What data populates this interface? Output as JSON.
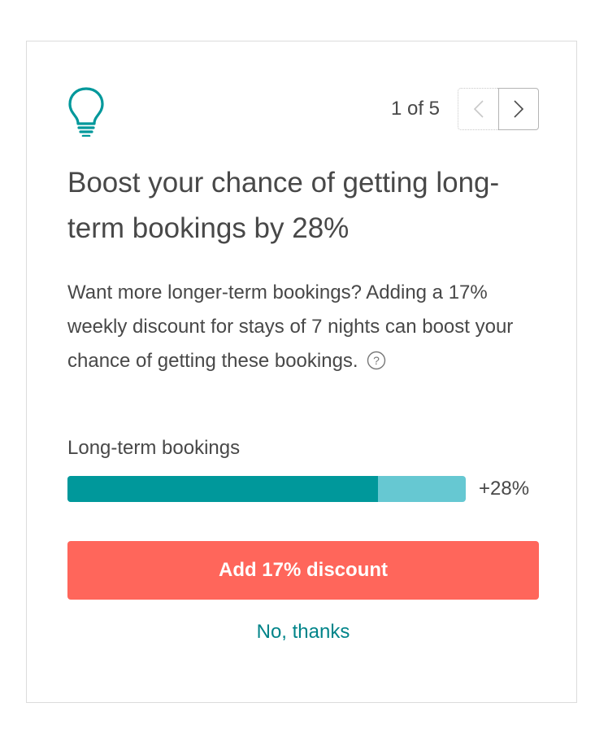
{
  "colors": {
    "accent": "#008489",
    "bar_fill": "#00989b",
    "bar_track": "#66c8d2",
    "primary_button": "#ff665b",
    "text": "#484848"
  },
  "icons": {
    "header": "lightbulb-icon",
    "prev": "chevron-left-icon",
    "next": "chevron-right-icon",
    "help": "question-circle-icon"
  },
  "pager": {
    "label": "1 of 5"
  },
  "card": {
    "headline": "Boost your chance of getting long-term bookings by 28%",
    "body": "Want more longer-term bookings? Adding a 17% weekly discount for stays of 7 nights can boost your chance of getting these bookings."
  },
  "metric": {
    "label": "Long-term bookings",
    "value_label": "+28%",
    "fill_fraction": 0.78
  },
  "actions": {
    "primary_label": "Add 17% discount",
    "secondary_label": "No, thanks"
  }
}
